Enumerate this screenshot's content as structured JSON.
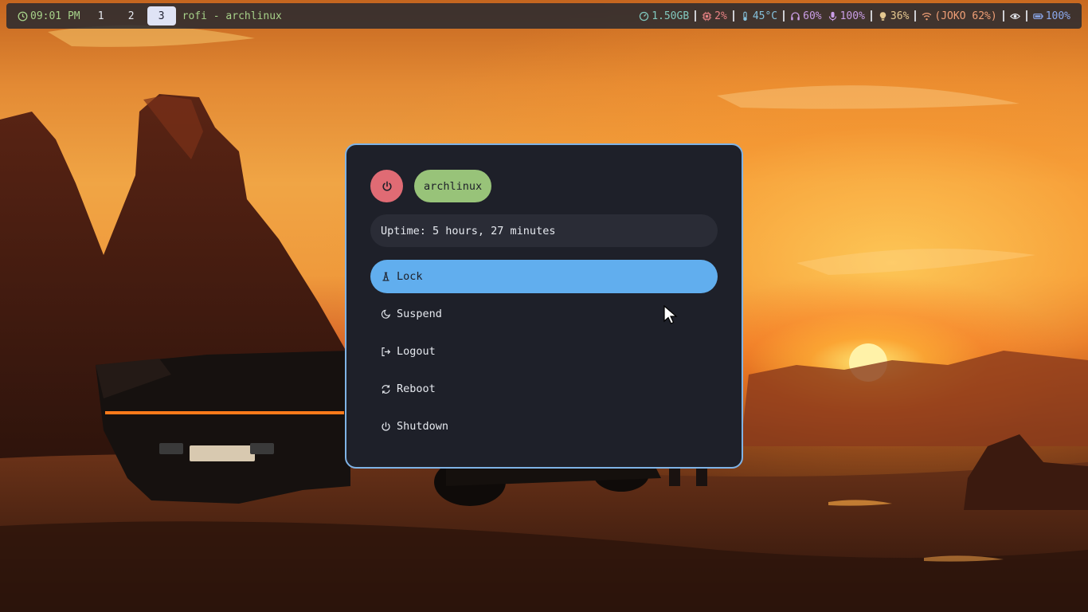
{
  "topbar": {
    "clock": "09:01 PM",
    "workspaces": [
      "1",
      "2",
      "3"
    ],
    "active_workspace": "3",
    "window_title": "rofi - archlinux",
    "memory": "1.50GB",
    "cpu": "2%",
    "temperature": "45°C",
    "volume": "60%",
    "mic": "100%",
    "brightness": "36%",
    "wifi": "(JOKO 62%)",
    "battery": "100%",
    "colors": {
      "memory": "#81c8be",
      "cpu": "#e78284",
      "temperature": "#85c1dc",
      "volume": "#ca9ee6",
      "mic": "#ca9ee6",
      "brightness": "#e5c890",
      "wifi": "#ef9f76",
      "battery": "#8caaee"
    }
  },
  "rofi": {
    "host": "archlinux",
    "uptime": "Uptime: 5 hours, 27 minutes",
    "items": [
      {
        "label": "Lock",
        "icon": "lock-icon",
        "selected": true
      },
      {
        "label": "Suspend",
        "icon": "moon-icon",
        "selected": false
      },
      {
        "label": "Logout",
        "icon": "logout-icon",
        "selected": false
      },
      {
        "label": "Reboot",
        "icon": "reboot-icon",
        "selected": false
      },
      {
        "label": "Shutdown",
        "icon": "power-icon",
        "selected": false
      }
    ],
    "colors": {
      "power_button": "#e06b74",
      "host_pill": "#98c379",
      "selected": "#61aeee",
      "border": "#7fb3e6"
    }
  }
}
